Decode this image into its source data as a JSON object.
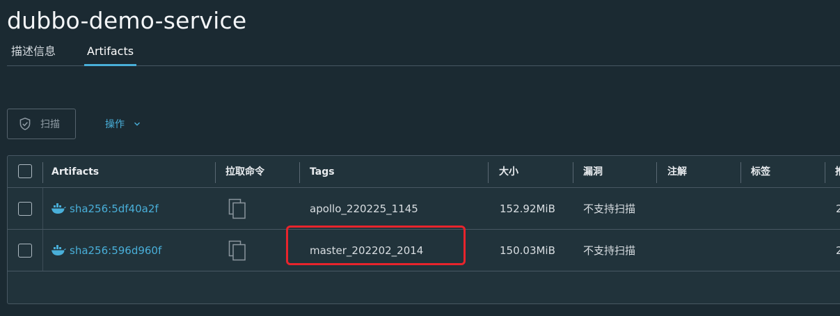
{
  "page": {
    "title": "dubbo-demo-service"
  },
  "tabs": [
    {
      "label": "描述信息"
    },
    {
      "label": "Artifacts"
    }
  ],
  "toolbar": {
    "scan_label": "扫描",
    "actions_label": "操作"
  },
  "table": {
    "headers": [
      "Artifacts",
      "拉取命令",
      "Tags",
      "大小",
      "漏洞",
      "注解",
      "标签",
      "推"
    ],
    "rows": [
      {
        "digest": "sha256:5df40a2f",
        "tag": "apollo_220225_1145",
        "size": "152.92MiB",
        "vuln": "不支持扫描",
        "extra": "2"
      },
      {
        "digest": "sha256:596d960f",
        "tag": "master_202202_2014",
        "size": "150.03MiB",
        "vuln": "不支持扫描",
        "extra": "2"
      }
    ]
  },
  "colors": {
    "accent": "#49afd9",
    "highlight": "#e8242c",
    "background": "#1b2a32"
  },
  "icons": {
    "scan": "shield-icon",
    "actions": "chevron-down-icon",
    "artifact": "docker-icon",
    "pull": "copy-icon"
  }
}
